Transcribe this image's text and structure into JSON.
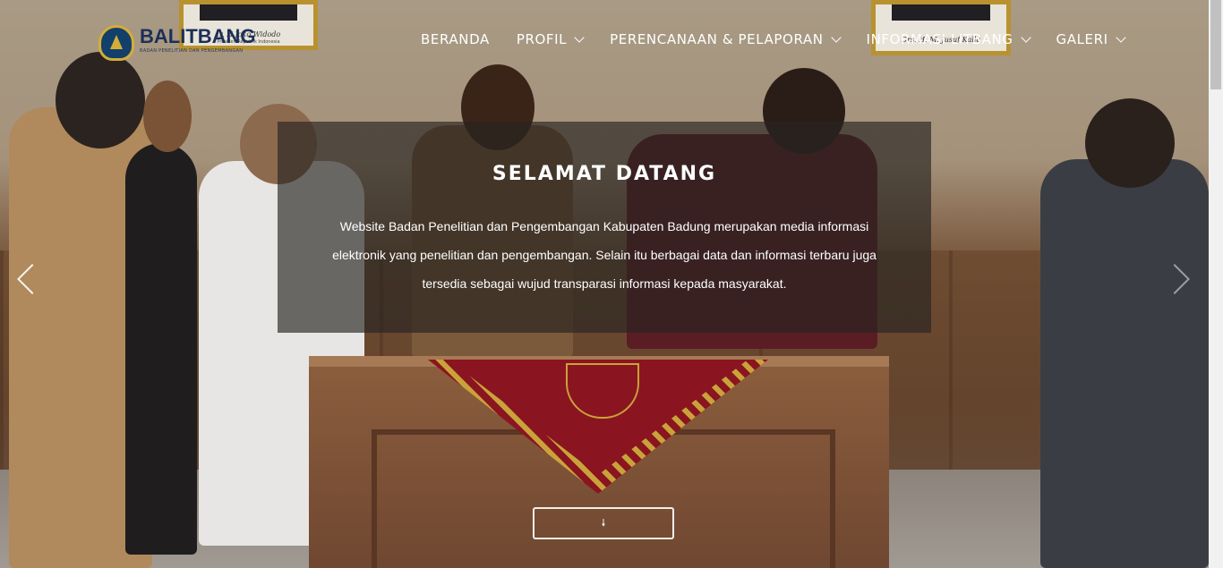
{
  "brand": {
    "title": "BALITBANG",
    "subtitle": "BADAN PENELITIAN DAN PENGEMBANGAN"
  },
  "nav": {
    "items": [
      {
        "label": "BERANDA",
        "has_dropdown": false
      },
      {
        "label": "PROFIL",
        "has_dropdown": true
      },
      {
        "label": "PERENCANAAN & PELAPORAN",
        "has_dropdown": true
      },
      {
        "label": "INFORMASI LITBANG",
        "has_dropdown": true
      },
      {
        "label": "GALERI",
        "has_dropdown": true
      }
    ]
  },
  "portraits": {
    "left_caption": "Ir. H Joko Widodo",
    "left_sub": "Presiden Republik Indonesia",
    "right_caption": "Drs. H. M. Jusuf Kalla"
  },
  "hero": {
    "title": "SELAMAT DATANG",
    "description": "Website Badan Penelitian dan Pengembangan Kabupaten Badung merupakan media informasi elektronik yang penelitian dan pengembangan. Selain itu berbagai data dan informasi terbaru juga tersedia sebagai wujud transparasi informasi kepada masyarakat.",
    "scroll_icon": "arrow-down-icon"
  },
  "colors": {
    "overlay": "#28242188",
    "brand_blue": "#1c2f5a",
    "gold": "#c9a23a"
  }
}
